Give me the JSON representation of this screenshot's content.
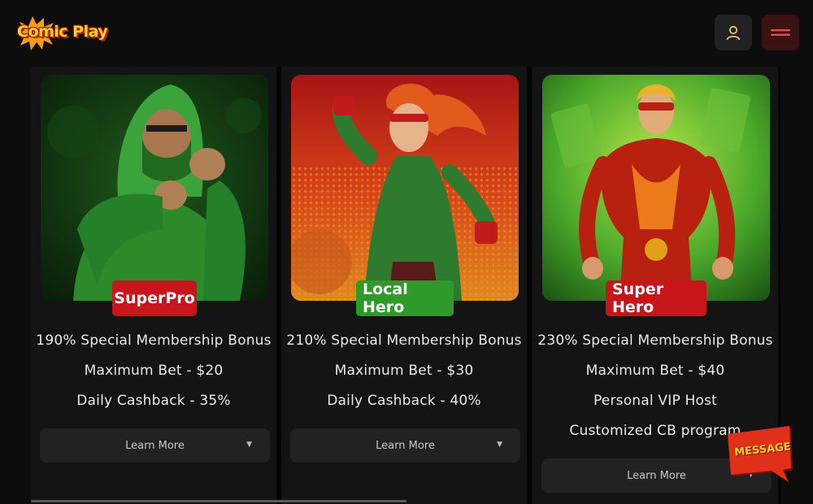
{
  "header": {
    "logo_text": "Comic Play",
    "user_button": "user-icon",
    "menu_button": "hamburger-menu-icon"
  },
  "colors": {
    "background": "#0d0d0e",
    "card": "#141415",
    "badge_red": "#c8151b",
    "badge_green": "#2f9a2a",
    "button": "#222224",
    "logo_yellow": "#ffd21f"
  },
  "cards": [
    {
      "badge": "SuperPro",
      "features": [
        "190% Special Membership Bonus",
        "Maximum Bet - $20",
        "Daily Cashback - 35%"
      ],
      "button": "Learn More"
    },
    {
      "badge": "Local Hero",
      "features": [
        "210% Special Membership Bonus",
        "Maximum Bet - $30",
        "Daily Cashback - 40%"
      ],
      "button": "Learn More"
    },
    {
      "badge": "Super Hero",
      "features": [
        "230% Special Membership Bonus",
        "Maximum Bet - $40",
        "Personal VIP Host",
        "Customized CB program"
      ],
      "button": "Learn More"
    }
  ],
  "message_widget": {
    "label": "MESSAGE"
  }
}
